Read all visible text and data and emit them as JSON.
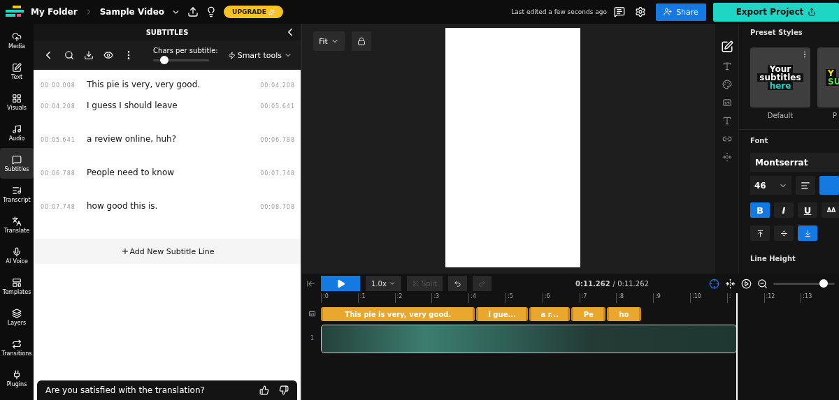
{
  "topbar": {
    "breadcrumb": [
      "My Folder",
      "Sample Video"
    ],
    "upgrade": "UPGRADE",
    "last_edited": "Last edited a few seconds ago",
    "share": "Share",
    "export": "Export Project"
  },
  "rail": [
    {
      "label": "Media",
      "selected": false
    },
    {
      "label": "Text",
      "selected": false
    },
    {
      "label": "Visuals",
      "selected": false
    },
    {
      "label": "Audio",
      "selected": false
    },
    {
      "label": "Subtitles",
      "selected": true
    },
    {
      "label": "Transcript",
      "selected": false
    },
    {
      "label": "Translate",
      "selected": false
    },
    {
      "label": "AI Voice",
      "selected": false
    },
    {
      "label": "Templates",
      "selected": false
    },
    {
      "label": "Layers",
      "selected": false
    },
    {
      "label": "Transitions",
      "selected": false
    },
    {
      "label": "Plugins",
      "selected": false
    }
  ],
  "subtitles_panel": {
    "title": "SUBTITLES",
    "chars_label": "Chars per subtitle:",
    "chars_slider": {
      "level": 0.2
    },
    "smart_tools": "Smart tools",
    "lines": [
      {
        "start": "00:00.008",
        "text": "This pie is very, very good.",
        "end": "00:04.208"
      },
      {
        "start": "00:04.208",
        "text": "I guess I should leave",
        "end": "00:05.641"
      },
      {
        "start": "00:05.641",
        "text": "a review online, huh?",
        "end": "00:06.788"
      },
      {
        "start": "00:06.788",
        "text": "People need to know",
        "end": "00:07.748"
      },
      {
        "start": "00:07.748",
        "text": "how good this is.",
        "end": "00:08.708"
      }
    ],
    "add_line": "Add New Subtitle Line",
    "feedback": "Are you satisfied with the translation?"
  },
  "preview": {
    "fit": "Fit"
  },
  "timeline": {
    "speed": "1.0x",
    "split": "Split",
    "current_time": "0:11.262",
    "total_time": "/ 0:11.262",
    "zoom_slider": {
      "level": 0.82
    },
    "ticks": [
      ":0",
      ":1",
      ":2",
      ":3",
      ":4",
      ":5",
      ":6",
      ":7",
      ":8",
      ":9",
      ":10",
      ":",
      ":12",
      ":13"
    ],
    "subtitle_clips": [
      "This pie is very, very good.",
      "I gue...",
      "a r...",
      "Pe",
      "ho"
    ],
    "video_track_label": "1"
  },
  "style_tools": [
    {
      "selected": true
    },
    {
      "selected": false
    },
    {
      "selected": false
    },
    {
      "selected": false
    },
    {
      "selected": false
    },
    {
      "selected": false
    },
    {
      "selected": false
    }
  ],
  "style_panel": {
    "preset_title": "Preset Styles",
    "presets": [
      {
        "preview": [
          "Your",
          "subtitles",
          "here"
        ],
        "label": "Default"
      },
      {
        "preview": [
          "Y",
          "SU"
        ],
        "label": "P"
      }
    ],
    "font_title": "Font",
    "font": "Montserrat",
    "size": "46",
    "format_buttons": [
      {
        "kind": "bold",
        "label": "B",
        "selected": true
      },
      {
        "kind": "italic",
        "label": "I",
        "selected": false
      },
      {
        "kind": "underline",
        "label": "U",
        "selected": false
      },
      {
        "kind": "caps",
        "label": "AA",
        "selected": false
      }
    ],
    "position_buttons": [
      {
        "kind": "top",
        "selected": false
      },
      {
        "kind": "middle",
        "selected": false
      },
      {
        "kind": "bottom",
        "selected": true
      }
    ],
    "line_height": "Line Height"
  }
}
